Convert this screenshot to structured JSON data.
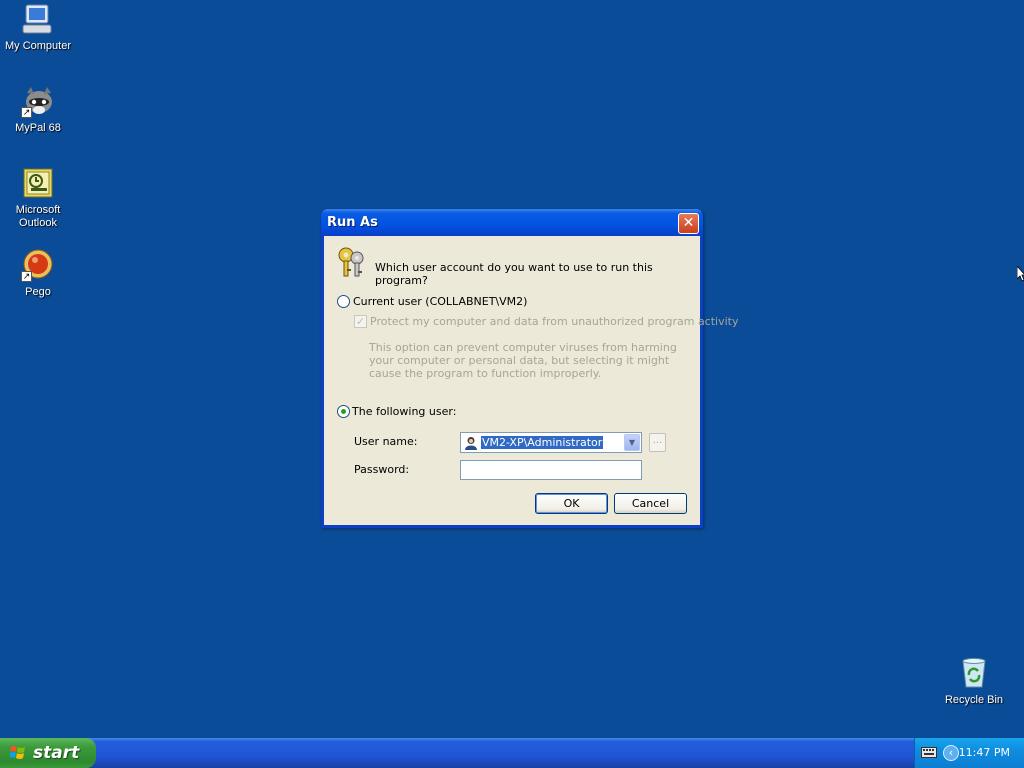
{
  "desktop": {
    "icons": [
      {
        "label": "My Computer"
      },
      {
        "label": "MyPal 68"
      },
      {
        "label": "Microsoft Outlook"
      },
      {
        "label": "Pego"
      },
      {
        "label": "Recycle Bin"
      }
    ]
  },
  "dialog": {
    "title": "Run As",
    "close_glyph": "✕",
    "question": "Which user account do you want to use to run this program?",
    "current_user": {
      "label": "Current user (COLLABNET\\VM2)",
      "selected": false
    },
    "protect_checkbox": {
      "label": "Protect my computer and data from unauthorized program activity",
      "checked": true,
      "enabled": false
    },
    "protect_description": "This option can prevent computer viruses from harming your computer or personal data, but selecting it might cause the program to function improperly.",
    "following_user": {
      "label": "The following user:",
      "selected": true
    },
    "username_label": "User name:",
    "username_value": "VM2-XP\\Administrator",
    "browse_label": "...",
    "password_label": "Password:",
    "password_value": "",
    "ok_label": "OK",
    "cancel_label": "Cancel"
  },
  "taskbar": {
    "start_label": "start",
    "clock": "11:47 PM"
  }
}
